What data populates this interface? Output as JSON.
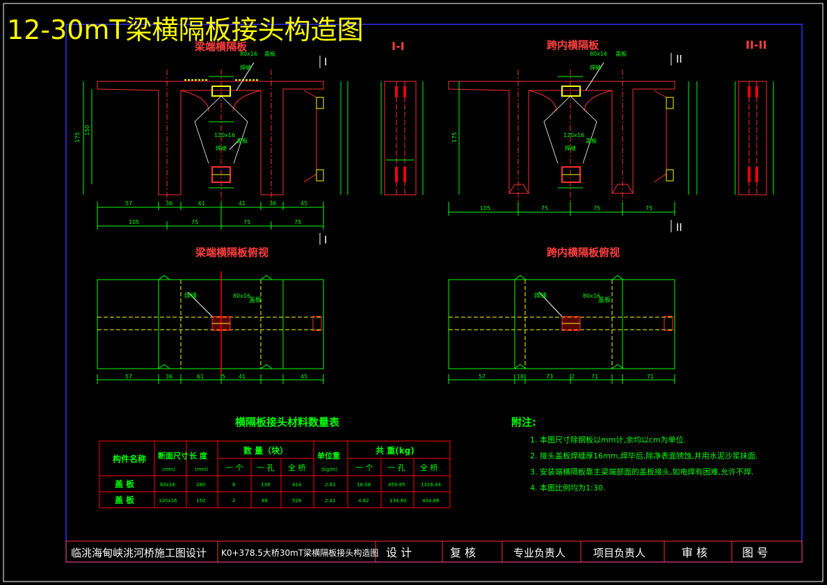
{
  "title": "12-30mT梁横隔板接头构造图",
  "views": {
    "end_diaphragm": "梁端横隔板",
    "section_1": "I-I",
    "mid_diaphragm": "跨内横隔板",
    "section_2": "II-II",
    "end_plan": "梁端横隔板俯视",
    "mid_plan": "跨内横隔板俯视",
    "mark_1": "I",
    "mark_2": "II"
  },
  "labels": {
    "cover_plate": "盖板",
    "weld": "焊缝",
    "plate_spec_a": "80x16",
    "plate_spec_b": "120x16",
    "height": "175",
    "height_inner": "150"
  },
  "dims": {
    "end_row1": [
      "57",
      "36",
      "61",
      "41",
      "36",
      "45"
    ],
    "end_row2": [
      "105",
      "75",
      "75",
      "75"
    ],
    "mid_row1": [
      "105",
      "75",
      "75",
      "75"
    ],
    "end_plan_row": [
      "57",
      "36",
      "61",
      "5",
      "41",
      "45"
    ],
    "mid_plan_row": [
      "57",
      "18",
      "73",
      "2",
      "71",
      "71"
    ]
  },
  "table": {
    "title": "横隔板接头材料数量表",
    "h_name": "构件名称",
    "h_section": "断面尺寸",
    "h_section_unit": "(mm)",
    "h_length": "长 度",
    "h_length_unit": "(mm)",
    "h_qty": "数 量（块）",
    "h_unit_wt": "单位重",
    "h_unit_wt_unit": "(kg/m)",
    "h_total": "共 重(kg)",
    "sub": [
      "一 个",
      "一 孔",
      "全 桥",
      "一 个",
      "一 孔",
      "全 桥"
    ],
    "rows": [
      [
        "盖 板",
        "80x16",
        "280",
        "6",
        "138",
        "414",
        "2.81",
        "16.08",
        "459.85",
        "1316.44"
      ],
      [
        "盖 板",
        "120x16",
        "150",
        "2",
        "88",
        "528",
        "2.41",
        "4.82",
        "134.60",
        "404.88"
      ]
    ]
  },
  "notes": {
    "title": "附注:",
    "items": [
      "1. 本图尺寸除钢板以mm计,余均以cm为单位.",
      "2. 接头盖板焊缝厚16mm,焊毕后,除净表面锈蚀,并用水泥沙浆抹面.",
      "3. 安装端横隔板靠主梁端部面的盖板接头,如电焊有困难,允许不焊.",
      "4. 本图比例均为1:30."
    ]
  },
  "title_block": {
    "project": "临洮海甸峡洮河桥施工图设计",
    "drawing": "K0+378.5大桥30mT梁横隔板接头构造图",
    "design": "设 计",
    "review": "复 核",
    "specialist": "专业负责人",
    "pm": "项目负责人",
    "audit": "审 核",
    "dwg_no": "图 号"
  }
}
